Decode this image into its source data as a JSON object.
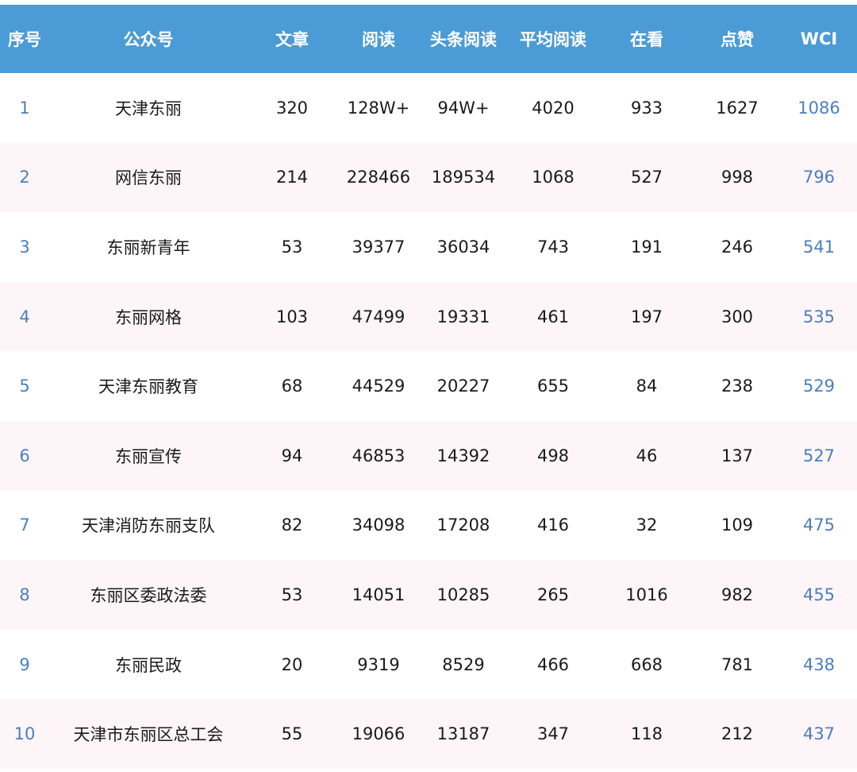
{
  "colors": {
    "header_bg": "#4b9bd6",
    "header_text": "#ffffff",
    "row_alt_bg": "#fdf5f8",
    "accent_text": "#4a7fc0"
  },
  "table": {
    "headers": [
      "序号",
      "公众号",
      "文章",
      "阅读",
      "头条阅读",
      "平均阅读",
      "在看",
      "点赞",
      "WCI"
    ],
    "rows": [
      [
        "1",
        "天津东丽",
        "320",
        "128W+",
        "94W+",
        "4020",
        "933",
        "1627",
        "1086"
      ],
      [
        "2",
        "网信东丽",
        "214",
        "228466",
        "189534",
        "1068",
        "527",
        "998",
        "796"
      ],
      [
        "3",
        "东丽新青年",
        "53",
        "39377",
        "36034",
        "743",
        "191",
        "246",
        "541"
      ],
      [
        "4",
        "东丽网格",
        "103",
        "47499",
        "19331",
        "461",
        "197",
        "300",
        "535"
      ],
      [
        "5",
        "天津东丽教育",
        "68",
        "44529",
        "20227",
        "655",
        "84",
        "238",
        "529"
      ],
      [
        "6",
        "东丽宣传",
        "94",
        "46853",
        "14392",
        "498",
        "46",
        "137",
        "527"
      ],
      [
        "7",
        "天津消防东丽支队",
        "82",
        "34098",
        "17208",
        "416",
        "32",
        "109",
        "475"
      ],
      [
        "8",
        "东丽区委政法委",
        "53",
        "14051",
        "10285",
        "265",
        "1016",
        "982",
        "455"
      ],
      [
        "9",
        "东丽民政",
        "20",
        "9319",
        "8529",
        "466",
        "668",
        "781",
        "438"
      ],
      [
        "10",
        "天津市东丽区总工会",
        "55",
        "19066",
        "13187",
        "347",
        "118",
        "212",
        "437"
      ]
    ]
  }
}
